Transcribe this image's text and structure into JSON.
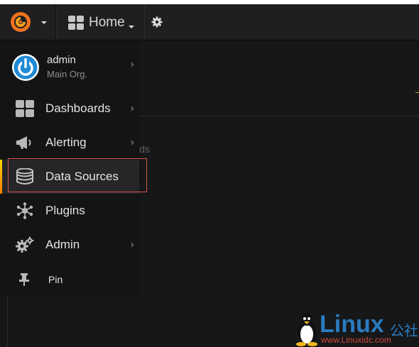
{
  "topbar": {
    "home_label": "Home",
    "logo_icon": "grafana-logo-icon",
    "settings_icon": "gear-icon"
  },
  "background": {
    "partial_text": "ds"
  },
  "sidemenu": {
    "user": {
      "name": "admin",
      "org": "Main Org."
    },
    "items": [
      {
        "label": "Dashboards",
        "icon": "dashboards-grid-icon",
        "has_submenu": true
      },
      {
        "label": "Alerting",
        "icon": "megaphone-icon",
        "has_submenu": true
      },
      {
        "label": "Data Sources",
        "icon": "database-icon",
        "has_submenu": false,
        "active": true
      },
      {
        "label": "Plugins",
        "icon": "plugins-icon",
        "has_submenu": false
      },
      {
        "label": "Admin",
        "icon": "cogs-icon",
        "has_submenu": true
      },
      {
        "label": "Pin",
        "icon": "pin-icon",
        "has_submenu": false
      }
    ]
  },
  "watermark": {
    "title": "Linux",
    "chinese": "公社",
    "url": "www.Linuxidc.com"
  },
  "colors": {
    "accent_gradient_start": "#ffd500",
    "accent_gradient_end": "#ff7c00",
    "highlight_border": "#d9534f",
    "avatar_blue": "#1f8ad6"
  }
}
